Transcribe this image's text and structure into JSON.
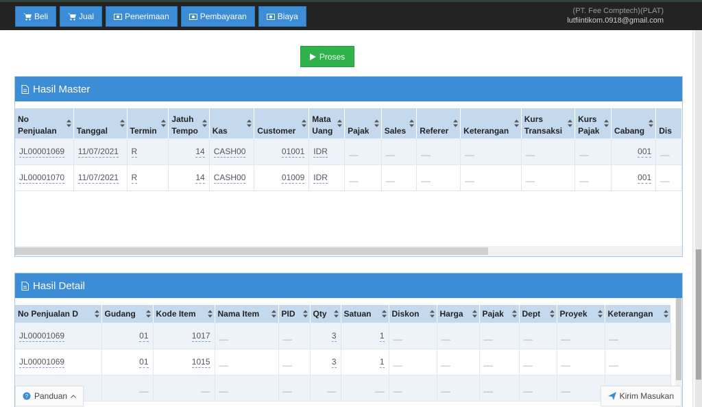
{
  "nav": [
    {
      "label": "Beli",
      "icon": "cart-icon"
    },
    {
      "label": "Jual",
      "icon": "cart-icon"
    },
    {
      "label": "Penerimaan",
      "icon": "money-icon"
    },
    {
      "label": "Pembayaran",
      "icon": "money-icon"
    },
    {
      "label": "Biaya",
      "icon": "money-icon"
    }
  ],
  "account": {
    "company": "(PT. Fee Comptech)(PLAT)",
    "email": "lutfiintikom.0918@gmail.com"
  },
  "proses_label": "Proses",
  "master": {
    "title": "Hasil Master",
    "headers": [
      [
        "No",
        "Penjualan"
      ],
      [
        "",
        "Tanggal"
      ],
      [
        "",
        "Termin"
      ],
      [
        "Jatuh",
        "Tempo"
      ],
      [
        "",
        "Kas"
      ],
      [
        "",
        "Customer"
      ],
      [
        "Mata",
        "Uang"
      ],
      [
        "",
        "Pajak"
      ],
      [
        "",
        "Sales"
      ],
      [
        "",
        "Referer"
      ],
      [
        "",
        "Keterangan"
      ],
      [
        "Kurs",
        "Transaksi"
      ],
      [
        "Kurs",
        "Pajak"
      ],
      [
        "",
        "Cabang"
      ],
      [
        "",
        "Dis"
      ]
    ],
    "rows": [
      [
        "JL00001069",
        "11/07/2021",
        "R",
        "14",
        "CASH00",
        "01001",
        "IDR",
        "",
        "",
        "",
        "",
        "",
        "",
        "001",
        ""
      ],
      [
        "JL00001070",
        "11/07/2021",
        "R",
        "14",
        "CASH00",
        "01009",
        "IDR",
        "",
        "",
        "",
        "",
        "",
        "",
        "001",
        ""
      ]
    ]
  },
  "detail": {
    "title": "Hasil Detail",
    "headers": [
      "No Penjualan D",
      "Gudang",
      "Kode Item",
      "Nama Item",
      "PID",
      "Qty",
      "Satuan",
      "Diskon",
      "Harga",
      "Pajak",
      "Dept",
      "Proyek",
      "Keterangan"
    ],
    "rows": [
      [
        "JL00001069",
        "01",
        "1017",
        "",
        "",
        "3",
        "1",
        "",
        "",
        "",
        "",
        "",
        ""
      ],
      [
        "JL00001069",
        "01",
        "1015",
        "",
        "",
        "3",
        "1",
        "",
        "",
        "",
        "",
        "",
        ""
      ],
      [
        "",
        "",
        "",
        "",
        "",
        "",
        "",
        "",
        "",
        "",
        "",
        "",
        ""
      ]
    ]
  },
  "footer": {
    "panduan": "Panduan",
    "kirim": "Kirim Masukan"
  },
  "colors": {
    "primary": "#3c8dd6",
    "success": "#2fb24a",
    "header_bg": "#c5d9ee",
    "topbar": "#232323"
  }
}
